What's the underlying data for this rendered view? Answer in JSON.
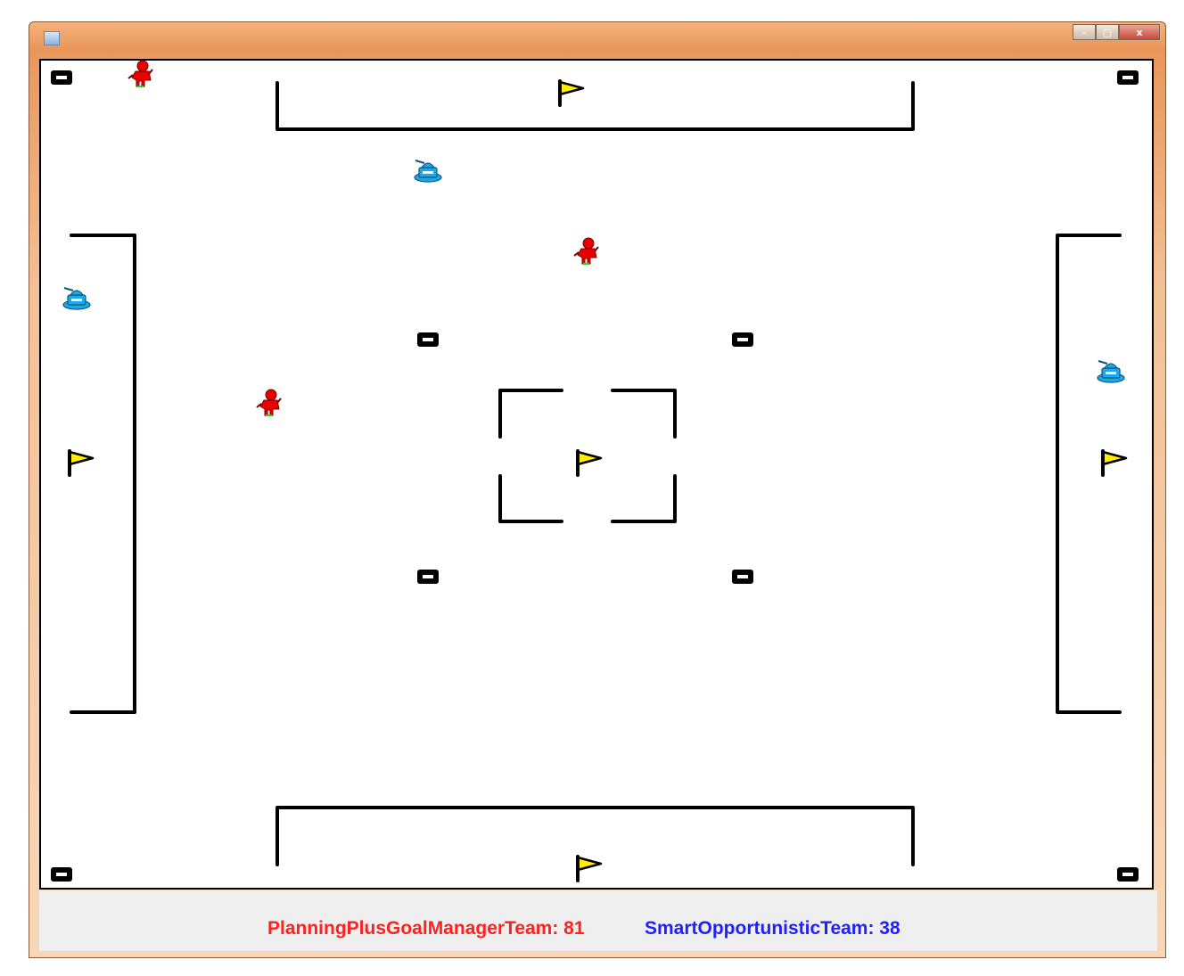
{
  "window": {
    "icon": "java-app-icon",
    "controls": {
      "minimize": "–",
      "maximize": "□",
      "close": "x"
    }
  },
  "scoreboard": {
    "red_team": "PlanningPlusGoalManagerTeam: 81",
    "blue_team": "SmartOpportunisticTeam: 38"
  },
  "colors": {
    "red_team": "#ff2020",
    "blue_team": "#2020ff",
    "tank": "#1ea8e8",
    "flag": "#ffee00",
    "wall": "#000000"
  }
}
